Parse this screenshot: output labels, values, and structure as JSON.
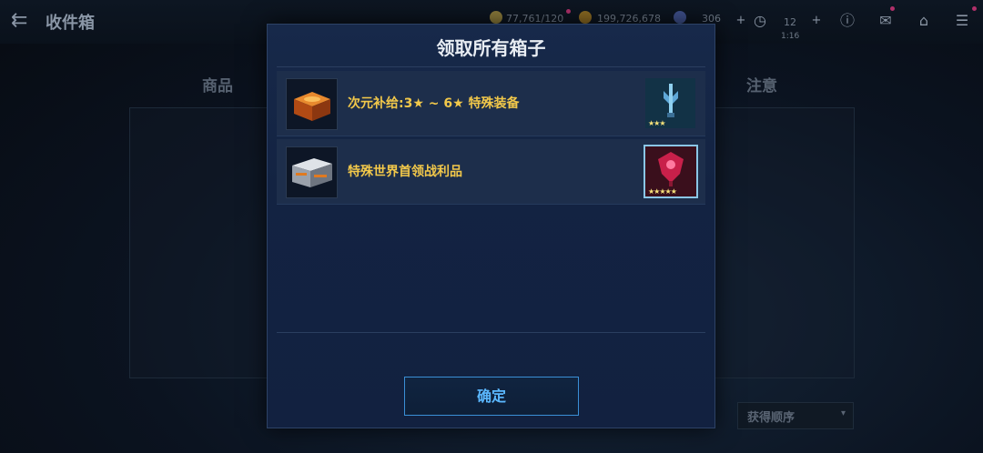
{
  "header": {
    "title": "收件箱",
    "resources": [
      {
        "value": "77,761/120",
        "color": "#e0b040"
      },
      {
        "value": "199,726,678",
        "color": "#d8a030"
      },
      {
        "value": "306",
        "color": "#6f8bd8"
      }
    ],
    "timer": {
      "count": "12",
      "time": "1:16"
    }
  },
  "columns": {
    "left": "商品",
    "right": "注意"
  },
  "sort": {
    "label": "获得顺序"
  },
  "modal": {
    "title": "领取所有箱子",
    "rewards": [
      {
        "label": "次元补给:3★ ~ 6★ 特殊装备",
        "stars": "★★★",
        "box_color": "#d7641e",
        "item_color": "#5fa8d8"
      },
      {
        "label": "特殊世界首领战利品",
        "stars": "★★★★★",
        "box_color": "#c9ced6",
        "item_color": "#c8204a"
      }
    ],
    "confirm_label": "确定"
  }
}
